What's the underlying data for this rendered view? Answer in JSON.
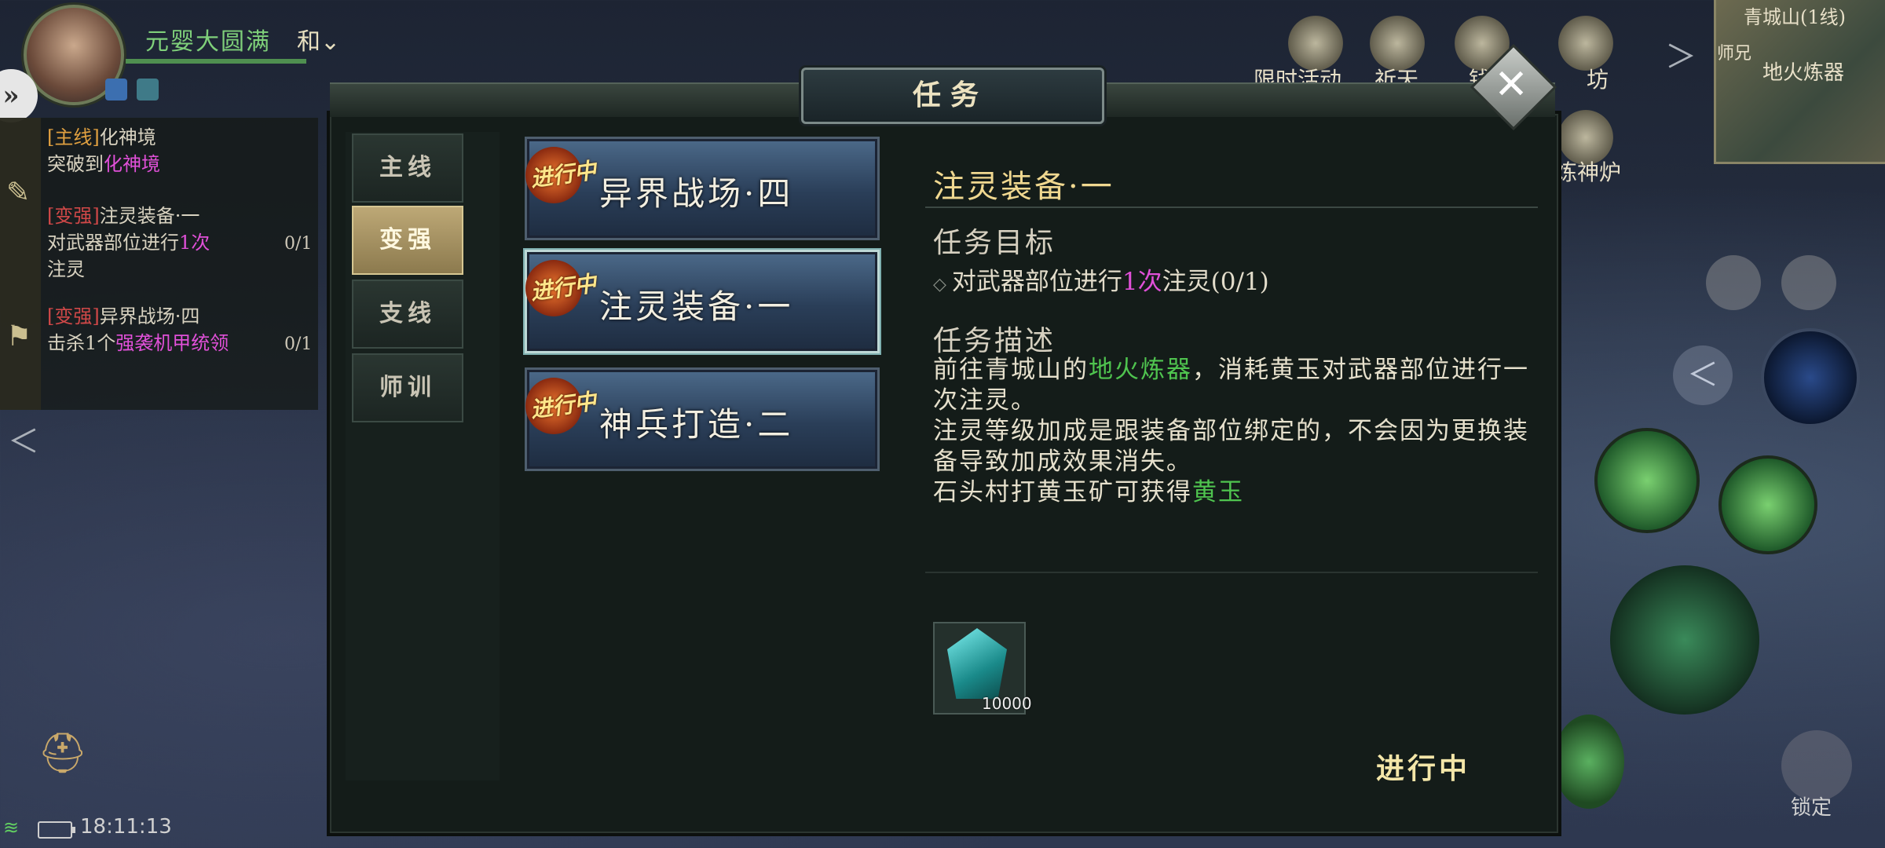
{
  "hud": {
    "realm": "元婴大圆满",
    "pk_mode": "和",
    "time": "18:11:13",
    "lock_label": "锁定"
  },
  "top_buttons": [
    {
      "label": "限时活动",
      "icon": "octopus-icon"
    },
    {
      "label": "祈天",
      "icon": "cauldron-icon"
    },
    {
      "label": "钱",
      "icon": "bill-icon"
    },
    {
      "label": "坊",
      "icon": "pavilion-icon"
    },
    {
      "label": "炼神炉",
      "icon": "furnace-icon"
    }
  ],
  "minimap": {
    "name": "青城山(1线)",
    "npc": "师兄",
    "place": "地火炼器"
  },
  "tracker": [
    {
      "tag": "[主线]",
      "name": "化神境",
      "desc_pre": "突破到",
      "desc_hl": "化神境",
      "desc_post": "",
      "progress": ""
    },
    {
      "tag": "[变强]",
      "name": "注灵装备·一",
      "desc_pre": "对武器部位进行",
      "desc_hl": "1次",
      "desc_post": "注灵",
      "progress": "0/1"
    },
    {
      "tag": "[变强]",
      "name": "异界战场·四",
      "desc_pre": "击杀1个",
      "desc_hl": "强袭机甲统领",
      "desc_post": "",
      "progress": "0/1"
    }
  ],
  "dialog": {
    "title": "任务",
    "tabs": [
      "主线",
      "变强",
      "支线",
      "师训"
    ],
    "active_tab": "变强",
    "quests": [
      {
        "name": "异界战场·四",
        "badge": "进行中"
      },
      {
        "name": "注灵装备·一",
        "badge": "进行中"
      },
      {
        "name": "神兵打造·二",
        "badge": "进行中"
      }
    ],
    "detail": {
      "title": "注灵装备·一",
      "objective_heading": "任务目标",
      "objective_pre": "对武器部位进行",
      "objective_num": "1次",
      "objective_post": "注灵(0/1)",
      "description_heading": "任务描述",
      "desc_line1_pre": "前往青城山的",
      "desc_line1_hl": "地火炼器",
      "desc_line1_post": "，消耗黄玉对武器部位进行一次注灵。",
      "desc_line2": "注灵等级加成是跟装备部位绑定的，不会因为更换装备导致加成效果消失。",
      "desc_line3_pre": "石头村打黄玉矿可获得",
      "desc_line3_hl": "黄玉",
      "reward_qty": "10000",
      "status": "进行中"
    }
  },
  "colors": {
    "highlight_pink": "#e050d8",
    "highlight_green": "#4fc44f",
    "tag_red": "#d04848",
    "title_gold": "#f0d890"
  }
}
